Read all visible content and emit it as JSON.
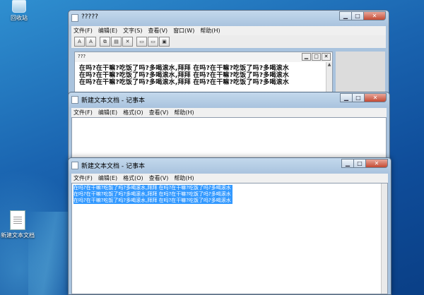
{
  "desktop": {
    "recycle_bin_label": "回收站",
    "text_file_label": "新建文本文档"
  },
  "main_window": {
    "title": "?????",
    "menu": [
      "文件(F)",
      "编辑(E)",
      "文字(S)",
      "查看(V)",
      "窗口(W)",
      "帮助(H)"
    ],
    "inner_title": "???",
    "lines": [
      "在吗?在干嘛?吃饭了吗?多喝滚水,拜拜 在吗?在干嘛?吃饭了吗?多喝滚水",
      "在吗?在干嘛?吃饭了吗?多喝滚水,拜拜 在吗?在干嘛?吃饭了吗?多喝滚水",
      "在吗?在干嘛?吃饭了吗?多喝滚水,拜拜 在吗?在干嘛?吃饭了吗?多喝滚水"
    ]
  },
  "notepad_back": {
    "title": "新建文本文档 - 记事本",
    "menu": [
      "文件(F)",
      "编辑(E)",
      "格式(O)",
      "查看(V)",
      "帮助(H)"
    ]
  },
  "notepad_front": {
    "title": "新建文本文档 - 记事本",
    "menu": [
      "文件(F)",
      "编辑(E)",
      "格式(O)",
      "查看(V)",
      "帮助(H)"
    ],
    "selected_lines": [
      "在吗?在干嘛?吃饭了吗?多喝滚水,拜拜 在吗?在干嘛?吃饭了吗?多喝滚水",
      "在吗?在干嘛?吃饭了吗?多喝滚水,拜拜 在吗?在干嘛?吃饭了吗?多喝滚水",
      "在吗?在干嘛?吃饭了吗?多喝滚水,拜拜 在吗?在干嘛?吃饭了吗?多喝滚水"
    ]
  },
  "caption_buttons": {
    "minimize": "▁",
    "maximize": "□",
    "close": "✕"
  },
  "icons": {
    "recycle_bin": "recycle-bin-icon",
    "text_file": "text-file-icon"
  }
}
